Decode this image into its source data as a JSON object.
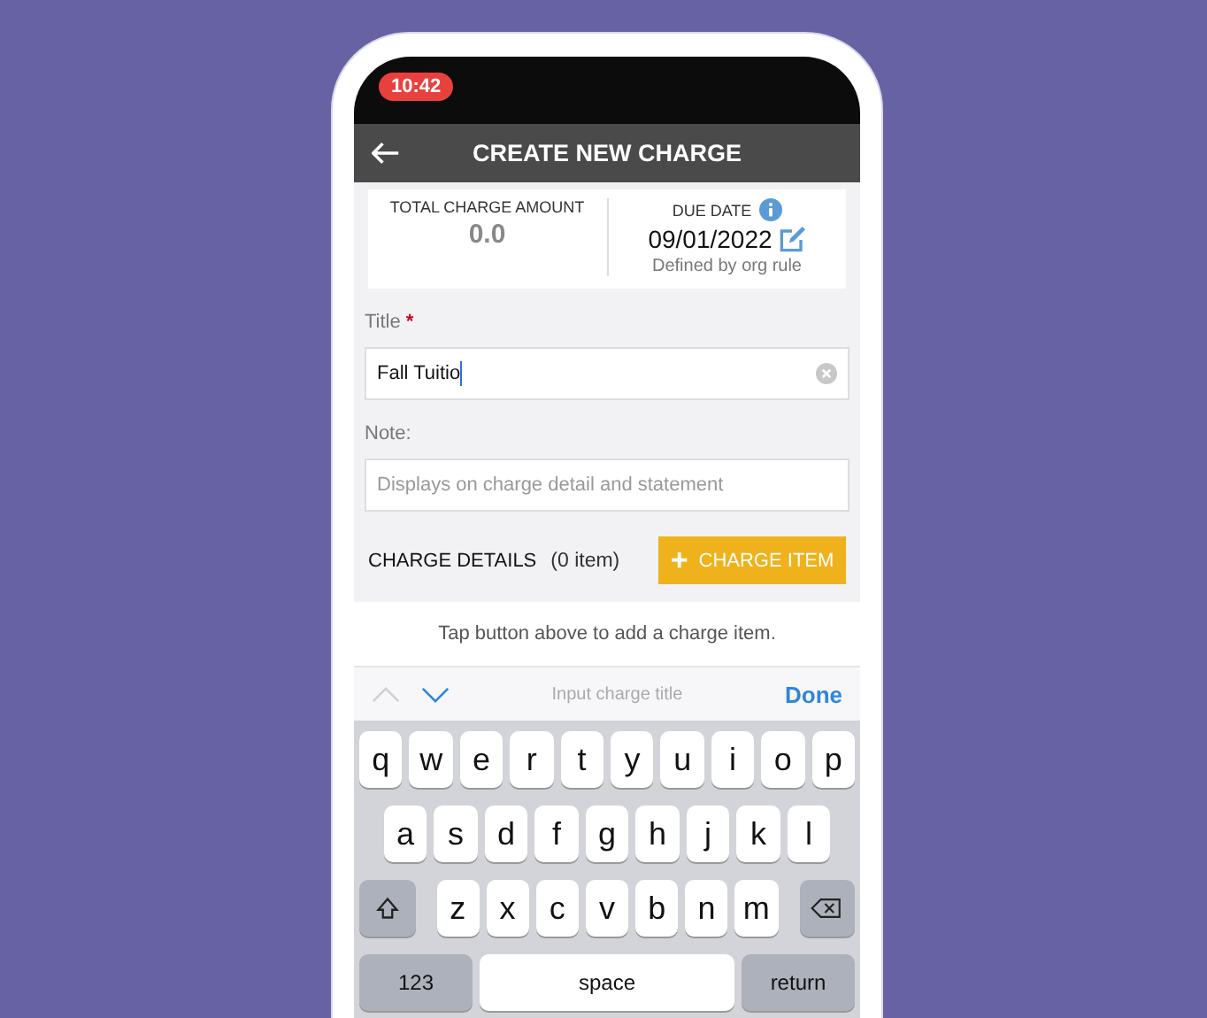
{
  "status_bar": {
    "time": "10:42"
  },
  "header": {
    "title": "CREATE NEW CHARGE"
  },
  "summary": {
    "total_label": "TOTAL CHARGE AMOUNT",
    "total_value": "0.0",
    "due_label": "DUE DATE",
    "due_value": "09/01/2022",
    "due_note": "Defined by org rule"
  },
  "form": {
    "title_label": "Title",
    "required_mark": "*",
    "title_value": "Fall Tuitio",
    "note_label": "Note:",
    "note_placeholder": "Displays on charge detail and statement"
  },
  "charge_details": {
    "label": "CHARGE DETAILS",
    "count": "(0 item)",
    "button": {
      "icon": "+",
      "label": "CHARGE ITEM"
    },
    "hint": "Tap button above to add a charge item."
  },
  "keyboard_toolbar": {
    "previous": {
      "disabled": true
    },
    "next": {
      "disabled": false
    },
    "placeholder": "Input charge title",
    "done": "Done"
  },
  "keyboard": {
    "rows": [
      [
        "q",
        "w",
        "e",
        "r",
        "t",
        "y",
        "u",
        "i",
        "o",
        "p"
      ],
      [
        "a",
        "s",
        "d",
        "f",
        "g",
        "h",
        "j",
        "k",
        "l"
      ],
      [
        "z",
        "x",
        "c",
        "v",
        "b",
        "n",
        "m"
      ]
    ],
    "bottom_row": [
      "123",
      "space",
      "return"
    ]
  }
}
